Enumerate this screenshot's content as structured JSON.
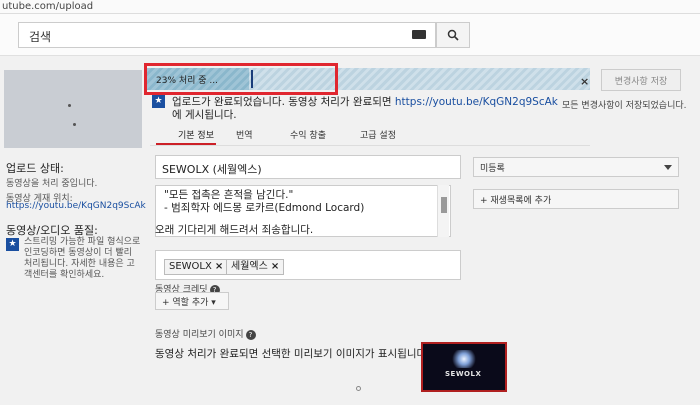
{
  "browser": {
    "url": "utube.com/upload"
  },
  "search": {
    "placeholder": "검색"
  },
  "progress": {
    "value_percent": 23,
    "text": "23% 처리 중 ...",
    "save_label": "변경사항 저장",
    "all_saved": "모든 변경사항이 저장되었습니다."
  },
  "upload": {
    "message": "업로드가 완료되었습니다. 동영상 처리가 완료되면",
    "link": "https://youtu.be/KqGN2q9ScAk",
    "message_end": "에 게시됩니다."
  },
  "sidebar": {
    "status_label": "업로드 상태:",
    "status_value": "동영상을 처리 중입니다.",
    "video_link_label": "동영상 게재 위치:",
    "video_link": "https://youtu.be/KqGN2q9ScAk",
    "quality_label": "동영상/오디오 품질:",
    "quality_text": "스트리밍 가능한 파일 형식으로 인코딩하면 동영상이 더 빨리 처리됩니다. 자세한 내용은 고객센터를 확인하세요."
  },
  "tabs": [
    "기본 정보",
    "번역",
    "수익 창출",
    "고급 설정"
  ],
  "form": {
    "title": "SEWOLX (세월엑스)",
    "description_lines": [
      "\"모든 접촉은 흔적을 남긴다.\"",
      "- 범죄학자 에드몽 로카르(Edmond Locard)"
    ],
    "description_extra": "오래 기다리게 해드려서 죄송합니다.",
    "tags": [
      "SEWOLX",
      "세월엑스"
    ],
    "credits_label": "동영상 크레딧",
    "role_button": "역할 추가",
    "thumbnail_label": "동영상 미리보기 이미지",
    "thumbnail_message": "동영상 처리가 완료되면 선택한 미리보기 이미지가 표시됩니다.",
    "preview_logo": "SEWOLX"
  },
  "right": {
    "privacy": "미등록",
    "playlist": "+ 재생목록에 추가"
  }
}
